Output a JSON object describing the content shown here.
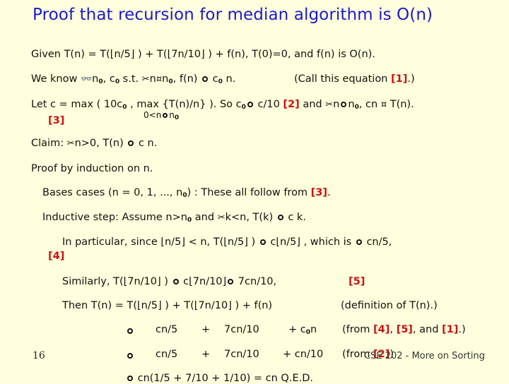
{
  "slide": {
    "title": "Proof that recursion for median algorithm is O(n)",
    "page_number": "16",
    "footer": "CSE 202 - More on Sorting",
    "accent_colors": {
      "title": "#1a1acc",
      "reference": "#cc1111",
      "background": "#ffffdd"
    }
  },
  "symbols": {
    "exists": "👓",
    "forall": "✂",
    "geq": "¤",
    "leq_icon": "circle-bullet"
  },
  "lines": {
    "given": "Given T(n) = T(⌊n/5⌋ ) + T(⌊7n/10⌋ ) + f(n), T(0)=0, and f(n) is O(n).",
    "know_a": "We know ",
    "know_b": "n",
    "know_b_sub": "0",
    "know_c": ", c",
    "know_c_sub": "0",
    "know_d": " s.t. ",
    "know_e": "n",
    "know_f": "n",
    "know_f_sub": "0",
    "know_g": ", f(n) ",
    "know_h": " c",
    "know_h_sub": "0",
    "know_i": " n.",
    "call_a": "(Call this equation ",
    "call_ref": "[1]",
    "call_b": ".)",
    "let_a": "Let c = max ( 10c",
    "let_a_sub": "0",
    "let_b": " , max {T(n)/n} ).  So c",
    "let_b_sub": "0",
    "let_c": " c/10 ",
    "let_ref": "[2]",
    "let_d": " and ",
    "let_e": "n",
    "let_f": "n",
    "let_f_sub": "0",
    "let_g": ", cn ",
    "let_h": " T(n).",
    "let_under_a": "0<n",
    "let_under_b": "n",
    "let_under_b_sub": "0",
    "let_ref3": "[3]",
    "claim_a": "Claim: ",
    "claim_b": "n>0, T(n) ",
    "claim_c": " c n.",
    "proof": "Proof by induction on n.",
    "base_a": "Bases cases (n = 0, 1, ..., n",
    "base_a_sub": "0",
    "base_b": ") : These all follow from ",
    "base_ref": "[3]",
    "base_c": ".",
    "ind_a": "Inductive step: Assume n>n",
    "ind_a_sub": "0",
    "ind_b": " and ",
    "ind_c": "k<n, T(k) ",
    "ind_d": " c k.",
    "part_a": "In particular, since ⌊n/5⌋ < n, T(⌊n/5⌋ ) ",
    "part_b": " c⌊n/5⌋ , which is ",
    "part_c": " cn/5,",
    "part_ref": "[4]",
    "sim_a": "Similarly, T(⌊7n/10⌋ ) ",
    "sim_b": " c⌊7n/10⌋",
    "sim_c": " 7cn/10,",
    "sim_ref": "[5]",
    "then_a": "Then  T(n) = T(⌊n/5⌋ ) + T(⌊7n/10⌋ ) + f(n)",
    "then_b": "(definition of T(n).)",
    "step1": {
      "t1": "cn/5",
      "plus1": "+",
      "t2": "7cn/10",
      "t3": "+ c",
      "t3_sub": "0",
      "t3_end": "n",
      "from_a": "(from ",
      "ref4": "[4]",
      "comma1": ", ",
      "ref5": "[5]",
      "and": ", and ",
      "ref1": "[1]",
      "close": ".)"
    },
    "step2": {
      "t1": "cn/5",
      "plus1": "+",
      "t2": "7cn/10",
      "t3": "+ cn/10",
      "from_a": "(from ",
      "ref2": "[2]",
      "close": ")"
    },
    "step3": " cn(1/5 + 7/10 + 1/10) = cn      Q.E.D."
  }
}
